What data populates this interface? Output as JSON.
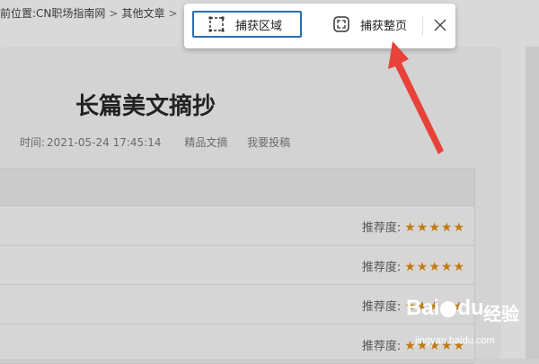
{
  "breadcrumb": {
    "prefix": "前位置:",
    "site": "CN职场指南网",
    "sep": ">",
    "category": "其他文章",
    "sep2": ">"
  },
  "article": {
    "title": "长篇美文摘抄",
    "time_label": "时间:",
    "time_value": "2021-05-24 17:45:14",
    "tag": "精品文摘",
    "submit": "我要投稿"
  },
  "table": {
    "rows": [
      {
        "rating_label": "推荐度:",
        "stars": "★★★★★"
      },
      {
        "rating_label": "推荐度:",
        "stars": "★★★★★"
      },
      {
        "rating_label": "推荐度:",
        "stars": "★★★★★"
      },
      {
        "rating_label": "推荐度:",
        "stars": "★★★★★"
      }
    ]
  },
  "toolbar": {
    "capture_region": "捕获区域",
    "capture_page": "捕获整页"
  },
  "watermark": {
    "brand": "Bai",
    "brand_suffix": "du",
    "jingyan": "经验",
    "url": "jingyan.baidu.com"
  },
  "colors": {
    "accent_border": "#2b6db0",
    "star": "#c27a10",
    "arrow": "#e8423a"
  }
}
